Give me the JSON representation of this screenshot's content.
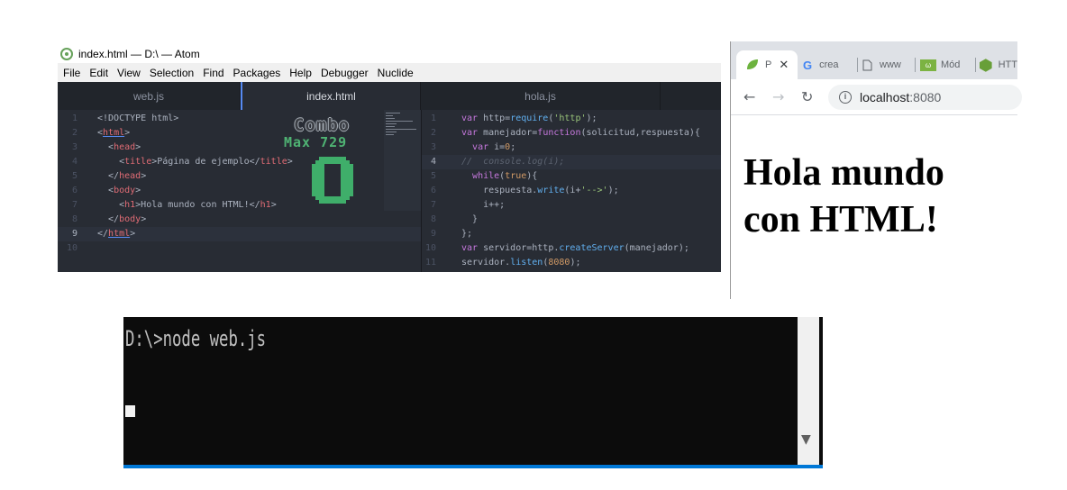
{
  "atom": {
    "title": "index.html — D:\\ — Atom",
    "menu": [
      "File",
      "Edit",
      "View",
      "Selection",
      "Find",
      "Packages",
      "Help",
      "Debugger",
      "Nuclide"
    ],
    "tabs": [
      {
        "label": "web.js",
        "active": false
      },
      {
        "label": "index.html",
        "active": true
      },
      {
        "label": "hola.js",
        "active": false
      }
    ],
    "line_numbers_left": [
      "1",
      "2",
      "3",
      "4",
      "5",
      "6",
      "7",
      "8",
      "9",
      "10"
    ],
    "line_numbers_right": [
      "1",
      "2",
      "3",
      "4",
      "5",
      "6",
      "7",
      "8",
      "9",
      "10",
      "11"
    ],
    "combo": {
      "word": "Combo",
      "max_label": "Max 729",
      "count": "0"
    }
  },
  "chrome": {
    "tabs": [
      {
        "icon": "spring-leaf-icon",
        "label": "P"
      },
      {
        "icon": "google-icon",
        "label": "crea"
      },
      {
        "icon": "page-icon",
        "label": "www"
      },
      {
        "icon": "modulo-icon",
        "label": "Mód"
      },
      {
        "icon": "node-hex-icon",
        "label": "HTT"
      }
    ],
    "url_host": "localhost",
    "url_port": ":8080",
    "heading": "Hola mundo con HTML!"
  },
  "console": {
    "command": "D:\\>node web.js"
  },
  "colors": {
    "atom_bg": "#282c34",
    "atom_tabbar": "#21252b",
    "atom_accent": "#568af2",
    "tag": "#e06c75",
    "keyword": "#c678dd",
    "string": "#98c379",
    "number": "#d19a66",
    "function": "#61afef",
    "console_bg": "#0c0c0c",
    "console_accent": "#0078d7"
  }
}
